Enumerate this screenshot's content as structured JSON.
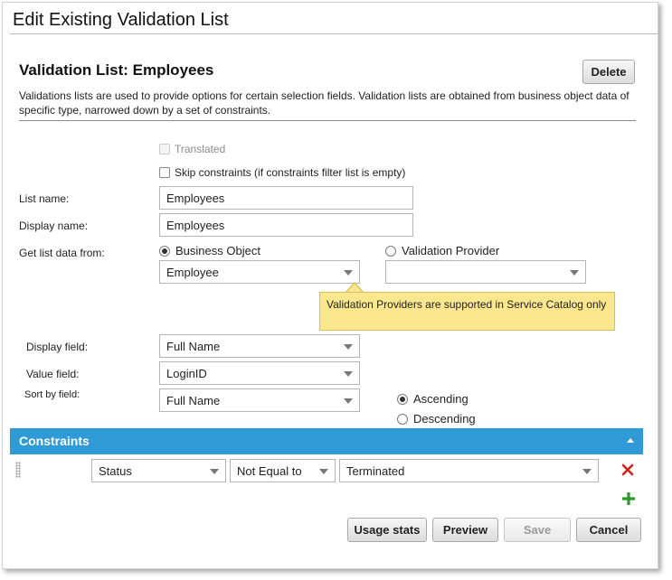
{
  "window": {
    "title": "Edit Existing Validation List"
  },
  "heading": "Validation List: Employees",
  "delete_button": "Delete",
  "description": "Validations lists are used to provide options for certain selection fields. Validation lists are obtained from business object data of specific type, narrowed down by a set of constraints.",
  "translated": {
    "label": "Translated",
    "checked": false,
    "disabled": true
  },
  "skip_constraints": {
    "label": "Skip constraints (if constraints filter list is empty)",
    "checked": false
  },
  "list_name": {
    "label": "List name:",
    "value": "Employees"
  },
  "display_name": {
    "label": "Display name:",
    "value": "Employees"
  },
  "get_list_data": {
    "label": "Get list data from:",
    "business_object": {
      "label": "Business Object",
      "selected": true,
      "value": "Employee"
    },
    "validation_provider": {
      "label": "Validation Provider",
      "selected": false,
      "value": ""
    }
  },
  "tooltip": "Validation Providers are supported in Service Catalog only",
  "display_field": {
    "label": "Display field:",
    "value": "Full Name"
  },
  "value_field": {
    "label": "Value field:",
    "value": "LoginID"
  },
  "sort_by_field": {
    "label": "Sort by field:",
    "value": "Full Name"
  },
  "sort_order": {
    "ascending": "Ascending",
    "descending": "Descending",
    "selected": "Ascending"
  },
  "constraints": {
    "title": "Constraints",
    "rows": [
      {
        "field": "Status",
        "operator": "Not Equal to",
        "value": "Terminated"
      }
    ]
  },
  "footer": {
    "usage_stats": "Usage stats",
    "preview": "Preview",
    "save": "Save",
    "cancel": "Cancel"
  },
  "colors": {
    "section_bar": "#2f9ad6",
    "tooltip_bg": "#fbe78d",
    "delete_red": "#d42020",
    "add_green": "#2a9a2a"
  }
}
